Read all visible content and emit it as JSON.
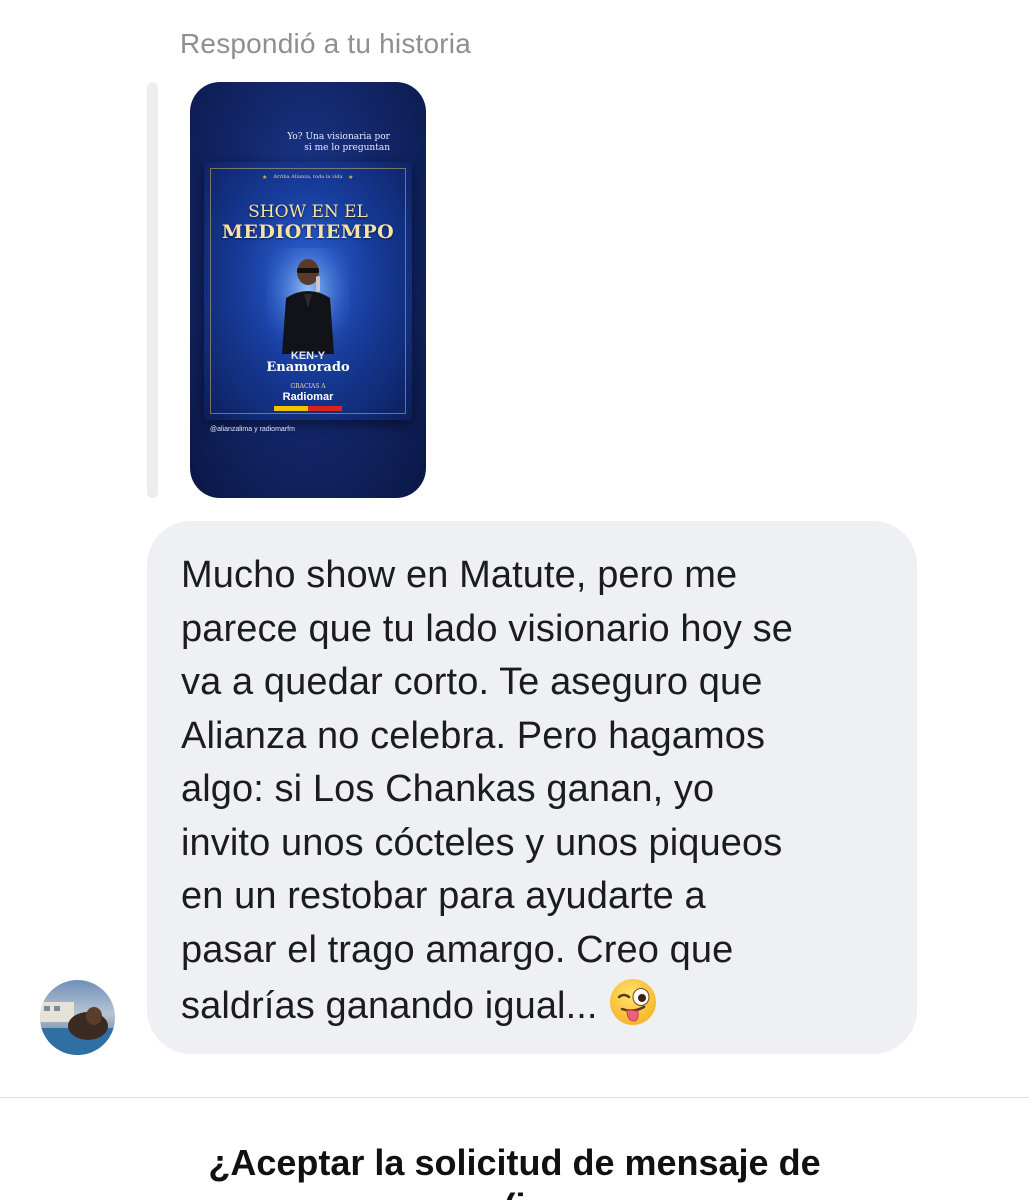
{
  "reply": {
    "header": "Respondió a tu historia"
  },
  "story": {
    "caption": "Yo? Una visionaria por si me lo preguntan",
    "mention": "@alianzalima y radiomarfm",
    "poster": {
      "tagline": "Arriba Alianza, toda la vida",
      "title_line1": "SHOW EN EL",
      "title_line2": "MEDIOTIEMPO",
      "artist_line1": "KEN-Y",
      "artist_line2": "Enamorado",
      "thanks": "GRACIAS A",
      "brand": "Radiomar"
    }
  },
  "message": {
    "text": "Mucho show en Matute, pero me\nparece que tu lado visionario hoy se\nva a quedar corto. Te aseguro que\nAlianza no celebra. Pero hagamos\nalgo: si Los Chankas ganan, yo\ninvito unos cócteles y unos piqueos\nen un restobar para ayudarte a\npasar el trago amargo. Creo que\nsaldrías ganando igual...",
    "emoji": "winking-face-with-tongue"
  },
  "request": {
    "title": "¿Aceptar la solicitud de mensaje de",
    "title_line2": "(i"
  },
  "colors": {
    "bubble": "#eff0f4",
    "muted_text": "#8e8e93",
    "story_blue": "#14286d"
  }
}
